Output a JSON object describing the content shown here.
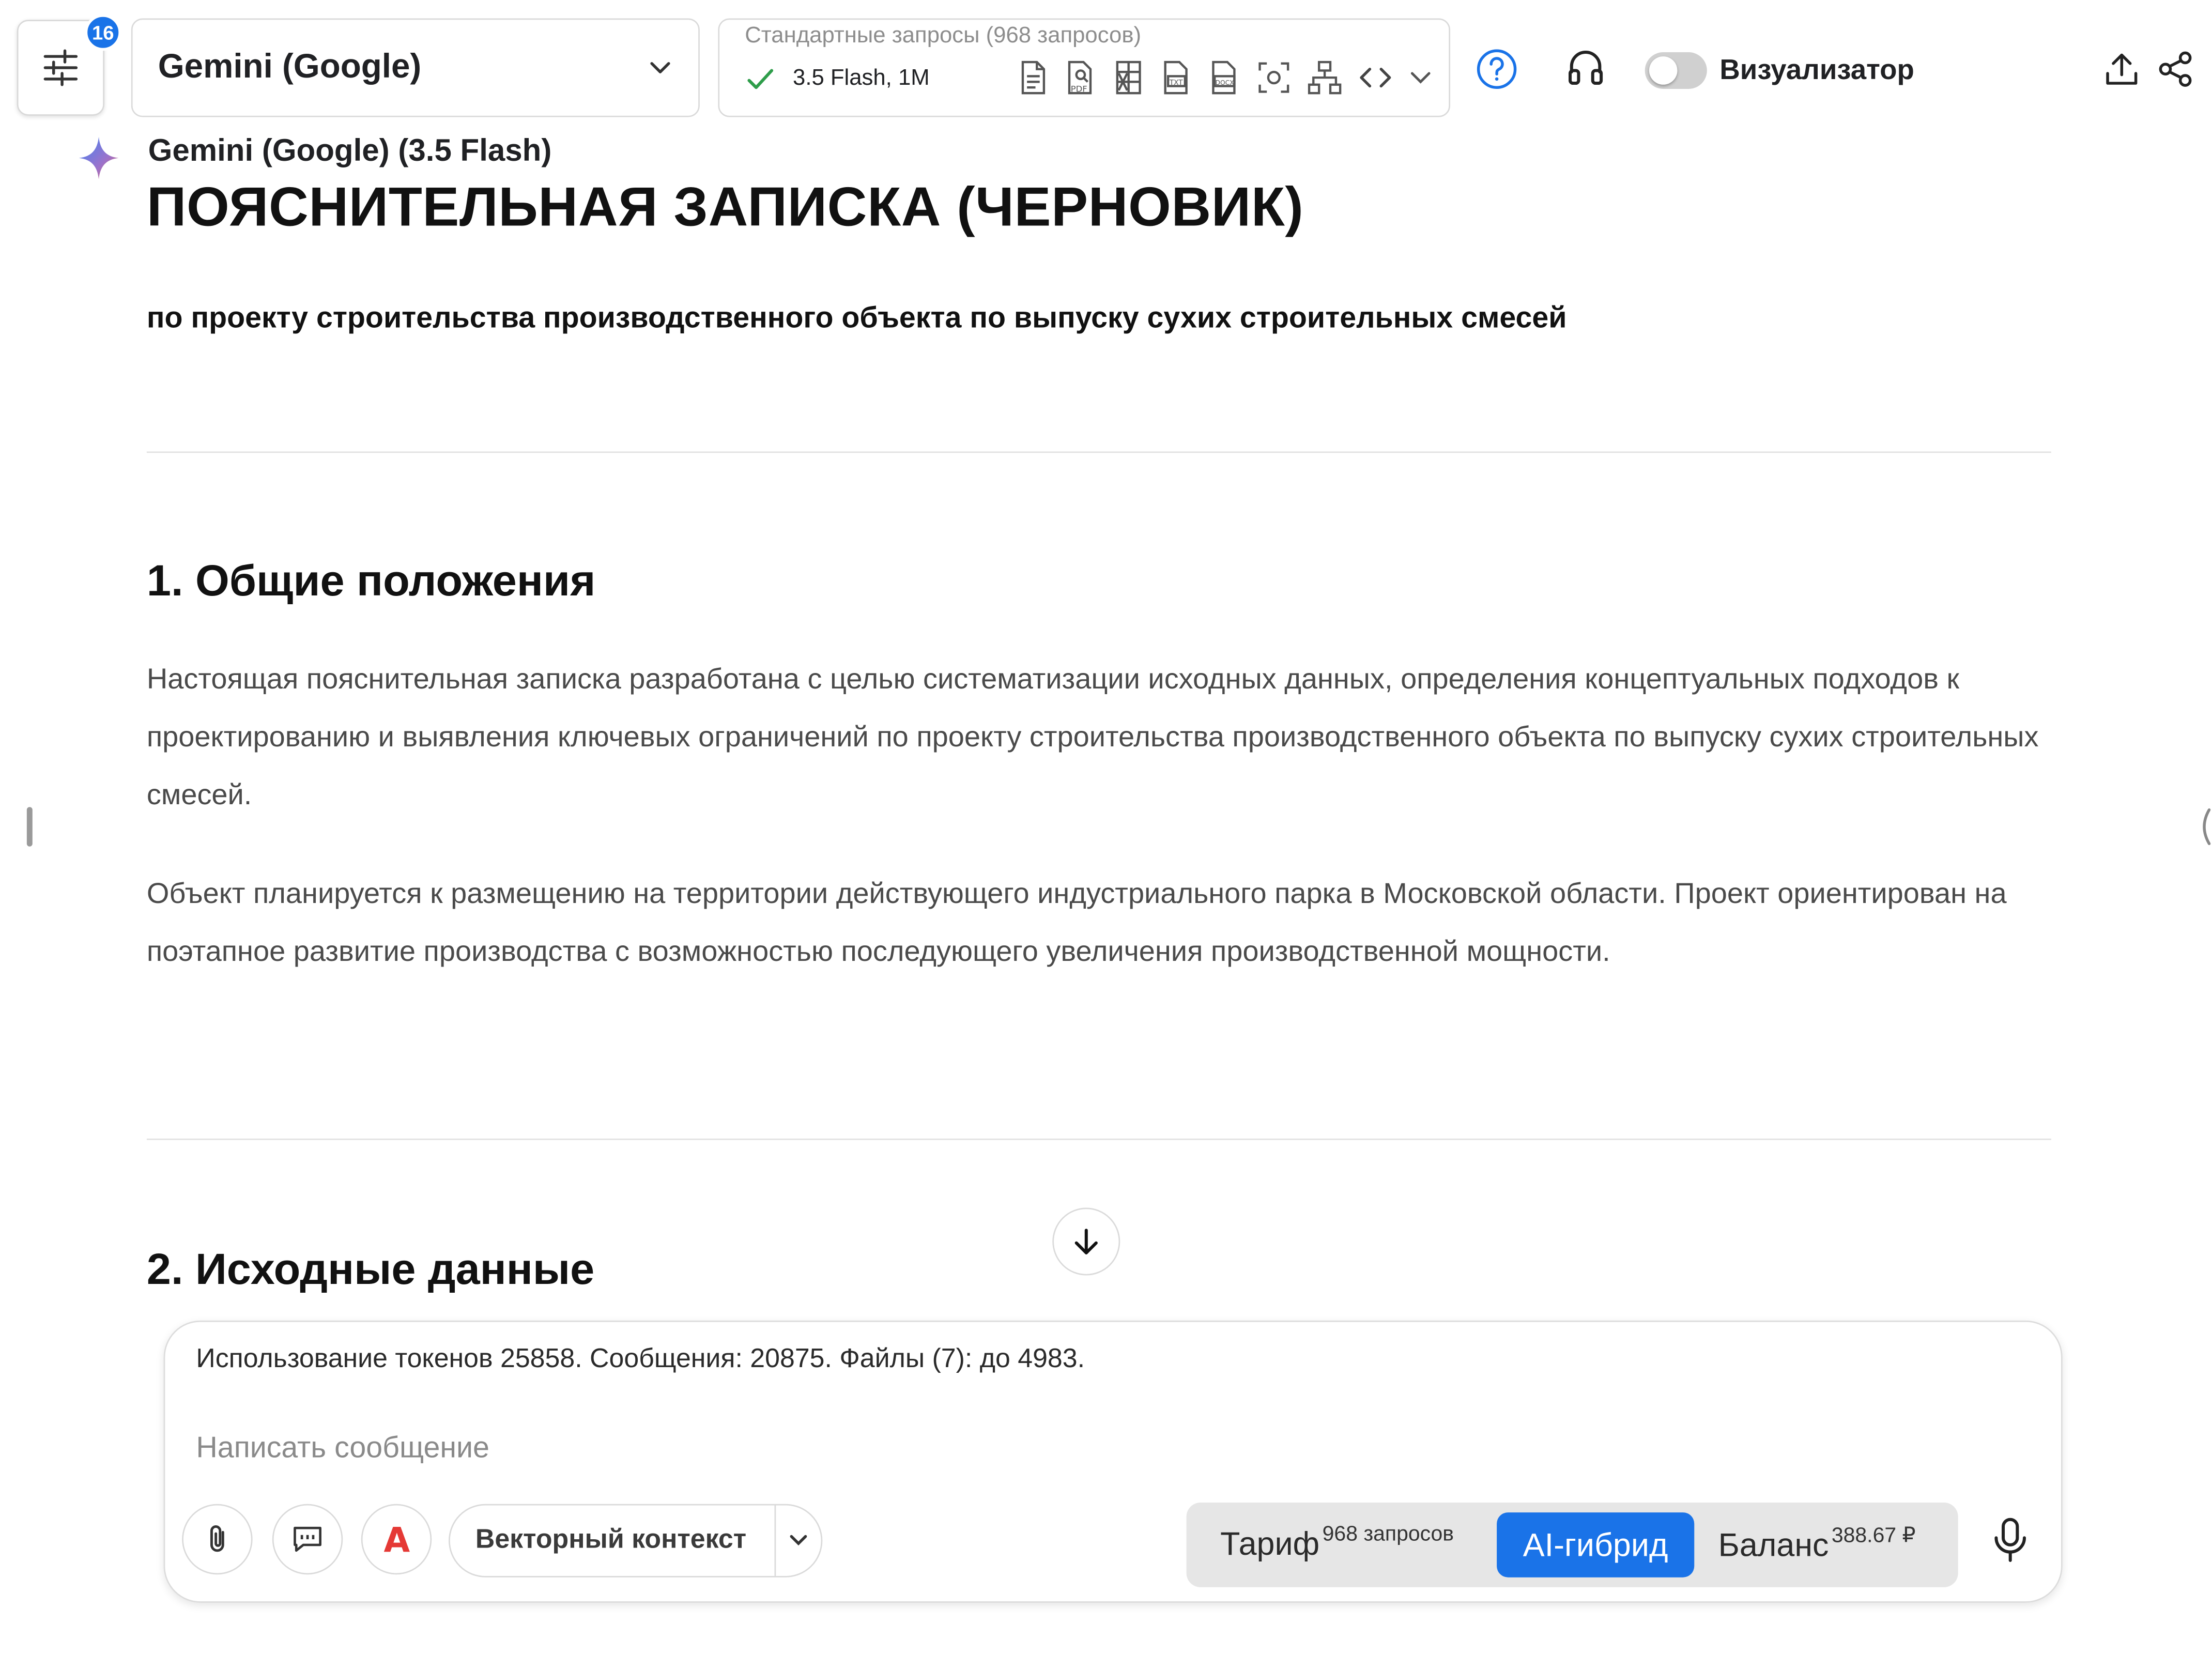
{
  "header": {
    "settings_badge": "16",
    "model_select": {
      "value": "Gemini (Google)"
    },
    "requests": {
      "title": "Стандартные запросы (968 запросов)",
      "model_info": "3.5 Flash, 1M",
      "tool_icons": [
        "document-icon",
        "pdf-search-icon",
        "excel-icon",
        "txt-file-icon",
        "docx-file-icon",
        "scan-icon",
        "sitemap-icon",
        "code-icon",
        "chevron-down-icon"
      ]
    },
    "visualizer_label": "Визуализатор",
    "visualizer_on": false
  },
  "document": {
    "author": "Gemini (Google) (3.5 Flash)",
    "title": "ПОЯСНИТЕЛЬНАЯ ЗАПИСКА (ЧЕРНОВИК)",
    "subtitle": "по проекту строительства производственного объекта по выпуску сухих строительных смесей",
    "sections": [
      {
        "heading": "1. Общие положения",
        "paragraphs": [
          "Настоящая пояснительная записка разработана с целью систематизации исходных данных, определения концептуальных подходов к проектированию и выявления ключевых ограничений по проекту строительства производственного объекта по выпуску сухих строительных смесей.",
          "Объект планируется к размещению на территории действующего индустриального парка в Московской области. Проект ориентирован на поэтапное развитие производства с возможностью последующего увеличения производственной мощности."
        ]
      },
      {
        "heading": "2. Исходные данные"
      }
    ]
  },
  "composer": {
    "usage": "Использование токенов 25858. Сообщения: 20875. Файлы (7): до 4983.",
    "placeholder": "Написать сообщение",
    "vector_context": "Векторный контекст",
    "modes": {
      "tarif": "Тариф",
      "tarif_sup": "968 запросов",
      "hybrid": "AI-гибрид",
      "balance": "Баланс",
      "balance_sup": "388.67 ₽"
    }
  },
  "colors": {
    "accent": "#1a73e8",
    "mode_bg": "#e6e6e6",
    "check": "#2e9d4a"
  }
}
